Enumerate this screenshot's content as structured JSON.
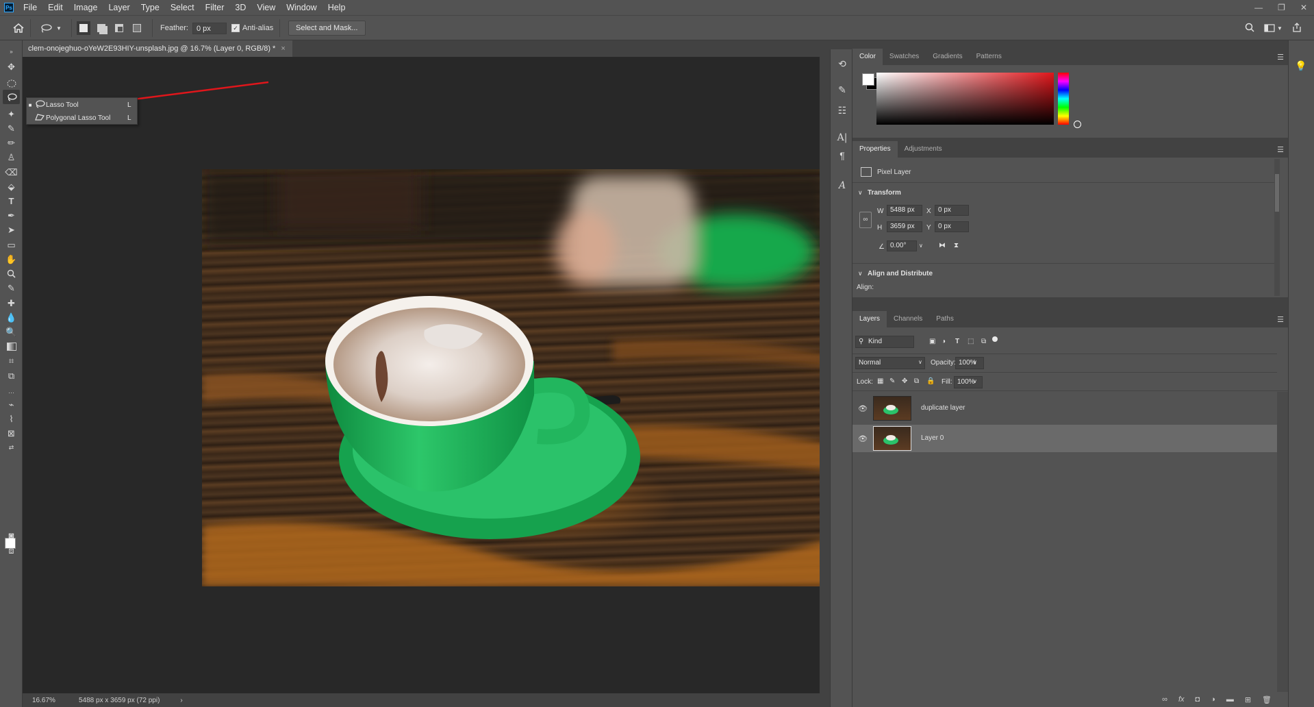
{
  "app": {
    "logo": "Ps"
  },
  "menu": [
    "File",
    "Edit",
    "Image",
    "Layer",
    "Type",
    "Select",
    "Filter",
    "3D",
    "View",
    "Window",
    "Help"
  ],
  "window_controls": [
    "—",
    "❐",
    "✕"
  ],
  "options": {
    "feather_label": "Feather:",
    "feather_value": "0 px",
    "antialias_label": "Anti-alias",
    "antialias_checked": true,
    "select_mask_label": "Select and Mask..."
  },
  "document": {
    "tab_title": "clem-onojeghuo-oYeW2E93HIY-unsplash.jpg @ 16.7% (Layer 0, RGB/8) *",
    "close": "×"
  },
  "tool_flyout": {
    "items": [
      {
        "label": "Lasso Tool",
        "shortcut": "L",
        "selected": true
      },
      {
        "label": "Polygonal Lasso Tool",
        "shortcut": "L",
        "selected": false
      }
    ]
  },
  "status": {
    "zoom": "16.67%",
    "doc_info": "5488 px x 3659 px (72 ppi)",
    "arrow": "›"
  },
  "color_panel": {
    "tabs": [
      "Color",
      "Swatches",
      "Gradients",
      "Patterns"
    ],
    "active_tab": 0
  },
  "properties_panel": {
    "tabs": [
      "Properties",
      "Adjustments"
    ],
    "layer_type": "Pixel Layer",
    "transform_label": "Transform",
    "w_label": "W",
    "w_value": "5488 px",
    "h_label": "H",
    "h_value": "3659 px",
    "x_label": "X",
    "x_value": "0 px",
    "y_label": "Y",
    "y_value": "0 px",
    "angle_value": "0.00°",
    "align_label": "Align and Distribute",
    "align_sub": "Align:"
  },
  "layers_panel": {
    "tabs": [
      "Layers",
      "Channels",
      "Paths"
    ],
    "filter_kind": "Kind",
    "blend_mode": "Normal",
    "opacity_label": "Opacity:",
    "opacity_value": "100%",
    "lock_label": "Lock:",
    "fill_label": "Fill:",
    "fill_value": "100%",
    "layers": [
      {
        "name": "duplicate layer",
        "visible": true,
        "selected": false
      },
      {
        "name": "Layer 0",
        "visible": true,
        "selected": true
      }
    ]
  },
  "colors": {
    "accent_red": "#e0161b",
    "cup_green": "#1fb25a"
  }
}
